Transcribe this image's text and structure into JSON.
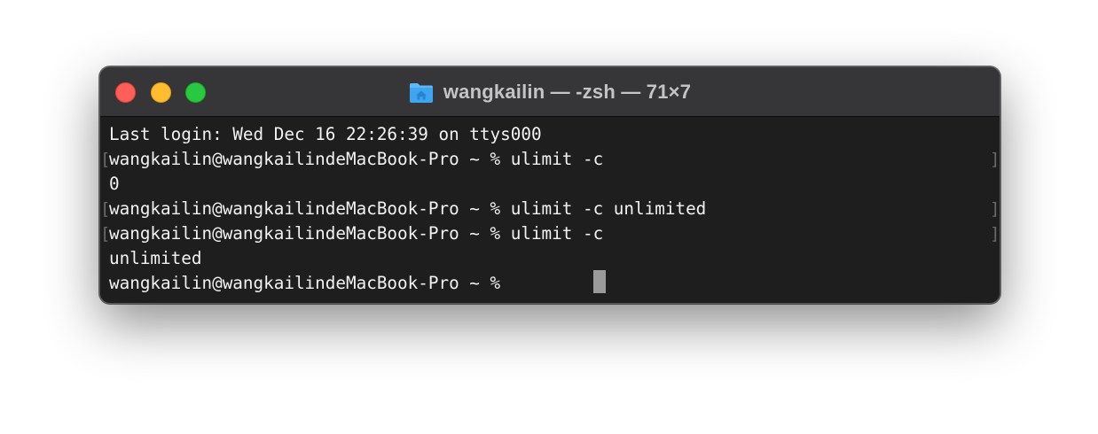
{
  "window": {
    "title": "wangkailin — -zsh — 71×7",
    "folder_icon": "home-folder-icon",
    "accent_colors": {
      "close": "#ff5f57",
      "minimize": "#febc2e",
      "zoom": "#28c840",
      "folder": "#3ea6f1"
    }
  },
  "terminal": {
    "lines": [
      {
        "text": "Last login: Wed Dec 16 22:26:39 on ttys000",
        "marked": false
      },
      {
        "text": "wangkailin@wangkailindeMacBook-Pro ~ % ulimit -c",
        "marked": true
      },
      {
        "text": "0",
        "marked": false
      },
      {
        "text": "wangkailin@wangkailindeMacBook-Pro ~ % ulimit -c unlimited",
        "marked": true
      },
      {
        "text": "wangkailin@wangkailindeMacBook-Pro ~ % ulimit -c",
        "marked": true
      },
      {
        "text": "unlimited",
        "marked": false
      },
      {
        "text": "wangkailin@wangkailindeMacBook-Pro ~ % ",
        "marked": false
      }
    ],
    "mark_left": "[",
    "mark_right": "]"
  }
}
